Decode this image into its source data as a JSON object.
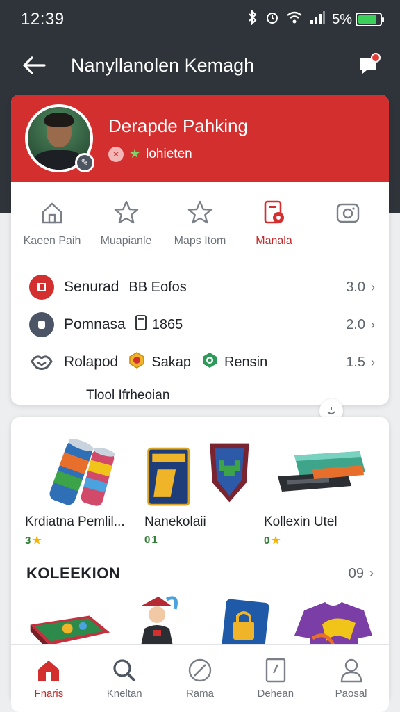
{
  "status_bar": {
    "time": "12:39",
    "battery_text": "5%",
    "battery_level": 0.85
  },
  "app_bar": {
    "title": "Nanyllanolen Kemagh"
  },
  "profile": {
    "name": "Derapde Pahking",
    "subtitle": "lohieten"
  },
  "tabs": [
    {
      "label": "Kaeen Paih",
      "icon": "home-icon"
    },
    {
      "label": "Muapianle",
      "icon": "star-icon"
    },
    {
      "label": "Maps Itom",
      "icon": "star-icon"
    },
    {
      "label": "Manala",
      "icon": "badge-icon",
      "active": true
    },
    {
      "label": "",
      "icon": "camera-icon"
    }
  ],
  "stats": [
    {
      "label": "Senurad",
      "extra": "BB Eofos",
      "value": "3.0",
      "icon_color": "#d32f2f",
      "icon": "shield-icon"
    },
    {
      "label": "Pomnasa",
      "extra": "1865",
      "value": "2.0",
      "icon_color": "#4b5566",
      "icon": "coin-icon"
    },
    {
      "label": "Rolapod",
      "extra_a": "Sakap",
      "extra_b": "Rensin",
      "value": "1.5",
      "icon_color": "#555b63",
      "icon": "handshake-icon"
    }
  ],
  "stats_footer": "Tlool Ifrheoian",
  "items": [
    {
      "name": "Krdiatna Pemlil...",
      "count": "3",
      "icon": "cans-icon"
    },
    {
      "name": "Nanekolaii",
      "count": "0",
      "count_suffix": "1",
      "icon": "card-pack-icon"
    },
    {
      "name": "Kollexin Utel",
      "count": "0",
      "icon": "keyboard-icon"
    }
  ],
  "collection": {
    "title": "KOLEEKION",
    "count": "09"
  },
  "bottom_nav": [
    {
      "label": "Fnaris",
      "icon": "home-icon",
      "active": true
    },
    {
      "label": "Kneltan",
      "icon": "search-icon"
    },
    {
      "label": "Rama",
      "icon": "compass-icon"
    },
    {
      "label": "Dehean",
      "icon": "document-icon"
    },
    {
      "label": "Paosal",
      "icon": "person-icon"
    }
  ],
  "colors": {
    "brand_red": "#d32f2f",
    "header_dark": "#2f343b",
    "count_green": "#2e7d32",
    "star_gold": "#f4b400"
  }
}
